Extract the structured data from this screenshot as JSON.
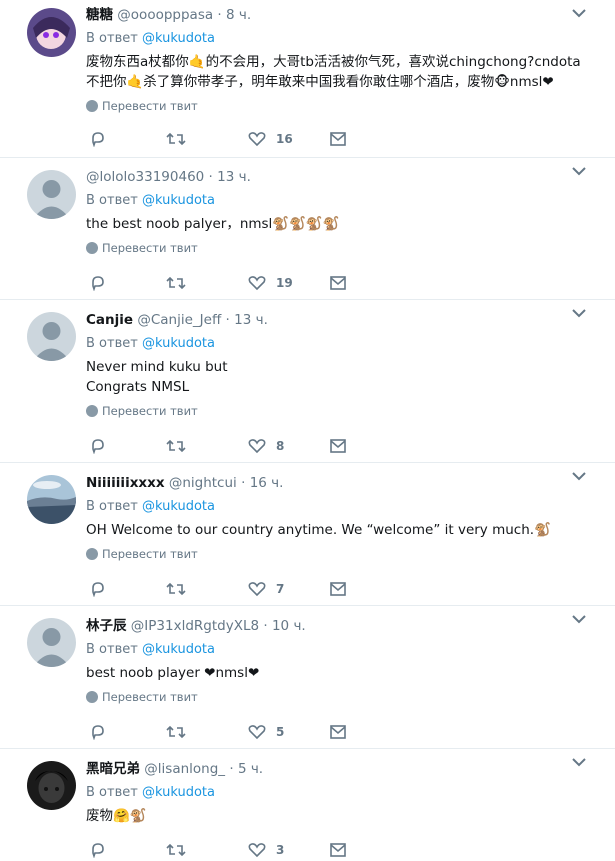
{
  "translate_label": "Перевести твит",
  "tweets": [
    {
      "name": "糖糖",
      "handle": "@oooopppasa",
      "time": "8 ч.",
      "reply_prefix": "В ответ",
      "reply_to": "@kukudota",
      "text_lines": [
        "废物东西a杖都你🤙的不会用，大哥tb活活被你气死，喜欢说chingchong?cndota",
        "不把你🤙杀了算你带孝子，明年敢来中国我看你敢住哪个酒店，废物🐵nmsl❤"
      ],
      "likes": "16"
    },
    {
      "name": "",
      "handle": "@lololo33190460",
      "time": "13 ч.",
      "reply_prefix": "В ответ",
      "reply_to": "@kukudota",
      "text_lines": [
        "the best noob palyer，nmsl🐒🐒🐒🐒"
      ],
      "likes": "19"
    },
    {
      "name": "Canjie",
      "handle": "@Canjie_Jeff",
      "time": "13 ч.",
      "reply_prefix": "В ответ",
      "reply_to": "@kukudota",
      "text_lines": [
        "Never mind kuku but",
        "Congrats NMSL"
      ],
      "likes": "8"
    },
    {
      "name": "Niiiiiiixxxx",
      "handle": "@nightcui",
      "time": "16 ч.",
      "reply_prefix": "В ответ",
      "reply_to": "@kukudota",
      "text_lines": [
        "OH Welcome to our country anytime. We “welcome” it very much.🐒"
      ],
      "likes": "7"
    },
    {
      "name": "林子辰",
      "handle": "@IP31xldRgtdyXL8",
      "time": "10 ч.",
      "reply_prefix": "В ответ",
      "reply_to": "@kukudota",
      "text_lines": [
        "best noob player ❤nmsl❤"
      ],
      "likes": "5"
    },
    {
      "name": "黑暗兄弟",
      "handle": "@lisanlong_",
      "time": "5 ч.",
      "reply_prefix": "В ответ",
      "reply_to": "@kukudota",
      "text_lines": [
        "废物🤗🐒"
      ],
      "likes": "3"
    }
  ],
  "icons": [
    "reply-icon",
    "retweet-icon",
    "like-icon",
    "message-icon",
    "chevron-down-icon",
    "globe-icon"
  ],
  "colors": {
    "link": "#1b95e0",
    "muted": "#657786",
    "divider": "#e6ecf0"
  }
}
